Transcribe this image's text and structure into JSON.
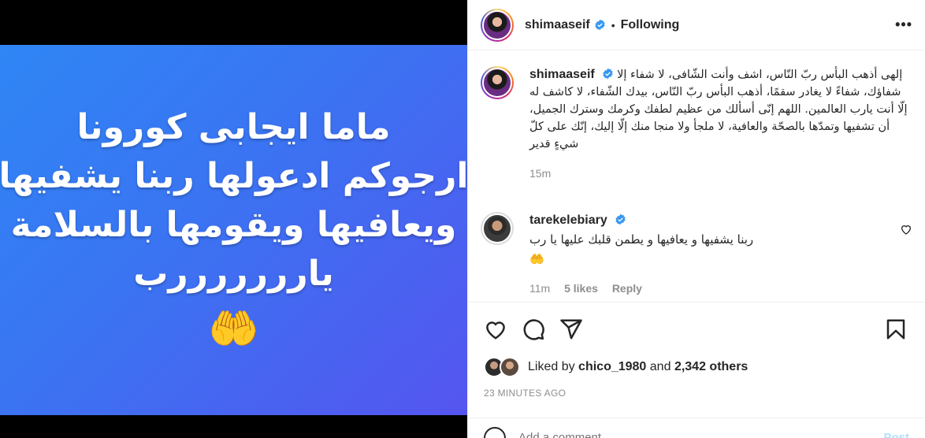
{
  "post": {
    "image_lines": [
      "ماما ايجابى كورونا",
      "ارجوكم ادعولها ربنا يشفيها",
      "ويعافيها ويقومها بالسلامة",
      "يارررررررب"
    ],
    "image_emoji": "🤲",
    "gradient_colors": [
      "#2f86f5",
      "#5555ef"
    ]
  },
  "header": {
    "username": "shimaaseif",
    "separator": "•",
    "follow_status": "Following",
    "more_label": "•••"
  },
  "caption": {
    "username": "shimaaseif",
    "text": "إلهى أذهب البأس ربّ النّاس، اشف وأنت الشّافى، لا شفاء إلا شفاؤك، شفاءً لا يغادر سقمًا، أذهب البأس ربّ النّاس، بيدك الشّفاء، لا كاشف له إلّا أنت يارب العالمين. اللهم إنّى أسألك من عظيم لطفك وكرمك وسترك الجميل، أن تشفيها وتمدّها بالصحّة والعافية، لا ملجأ ولا منجا منك إلّا إليك، إنّك على كلّ شيءٍ قدير",
    "time": "15m"
  },
  "comments": [
    {
      "username": "tarekelebiary",
      "text": "ربنا يشفيها و يعافيها و يطمن قلبك عليها يا رب",
      "emoji": "🤲",
      "time": "11m",
      "likes": "5 likes",
      "reply": "Reply"
    }
  ],
  "likes": {
    "prefix": "Liked by",
    "user": "chico_1980",
    "and": "and",
    "others": "2,342 others"
  },
  "timestamp": "23 MINUTES AGO",
  "add_comment": {
    "placeholder": "Add a comment…",
    "post_label": "Post"
  },
  "colors": {
    "verified": "#3897f0",
    "muted": "#8e8e8e",
    "post_button": "#b2dffc"
  }
}
